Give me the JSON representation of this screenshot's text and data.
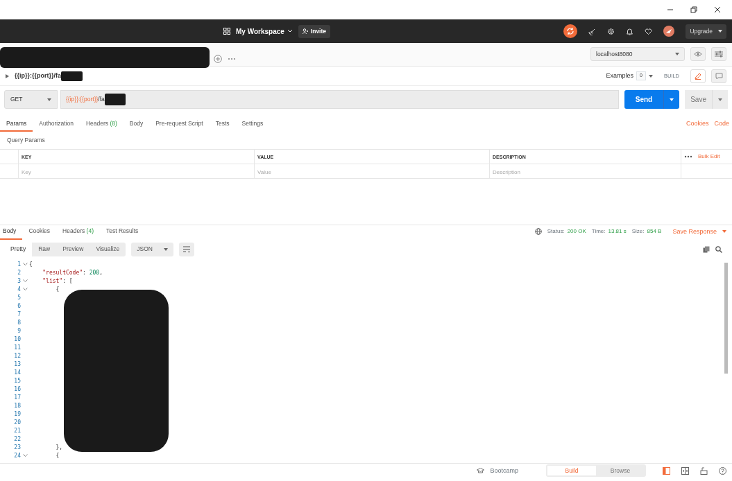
{
  "header": {
    "workspace": "My Workspace",
    "invite": "Invite",
    "upgrade": "Upgrade"
  },
  "environment": "localhost8080",
  "request_name": "{{ip}}:{{port}}/fa",
  "examples": {
    "label": "Examples",
    "count": "0"
  },
  "build_label": "BUILD",
  "url_bar": {
    "method": "GET",
    "variable": "{{ip}}:{{port}}",
    "path": "/fa",
    "send": "Send",
    "save": "Save"
  },
  "request_tabs": [
    {
      "label": "Params",
      "selected": true
    },
    {
      "label": "Authorization",
      "selected": false
    },
    {
      "label": "Headers",
      "count": "(8)",
      "selected": false
    },
    {
      "label": "Body",
      "selected": false
    },
    {
      "label": "Pre-request Script",
      "selected": false
    },
    {
      "label": "Tests",
      "selected": false
    },
    {
      "label": "Settings",
      "selected": false
    }
  ],
  "request_links": [
    "Cookies",
    "Code"
  ],
  "query_params": {
    "title": "Query Params",
    "columns": [
      "KEY",
      "VALUE",
      "DESCRIPTION"
    ],
    "placeholders": [
      "Key",
      "Value",
      "Description"
    ],
    "bulk_edit": "Bulk Edit"
  },
  "response_tabs": [
    {
      "label": "Body",
      "selected": true
    },
    {
      "label": "Cookies",
      "selected": false
    },
    {
      "label": "Headers",
      "count": "(4)",
      "selected": false
    },
    {
      "label": "Test Results",
      "selected": false
    }
  ],
  "status": [
    {
      "label": "Status:",
      "value": "200 OK"
    },
    {
      "label": "Time:",
      "value": "13.81 s"
    },
    {
      "label": "Size:",
      "value": "854 B"
    }
  ],
  "save_response": "Save Response",
  "view_modes": [
    {
      "label": "Pretty",
      "selected": true
    },
    {
      "label": "Raw",
      "selected": false
    },
    {
      "label": "Preview",
      "selected": false
    },
    {
      "label": "Visualize",
      "selected": false
    }
  ],
  "format": "JSON",
  "code_lines": [
    {
      "number": "1",
      "foldable": true,
      "tokens": [
        {
          "kind": "punct",
          "text": "{"
        }
      ]
    },
    {
      "number": "2",
      "foldable": false,
      "tokens": [
        {
          "kind": "key",
          "text": "    \"resultCode\""
        },
        {
          "kind": "punct",
          "text": ": "
        },
        {
          "kind": "number",
          "text": "200"
        },
        {
          "kind": "punct",
          "text": ","
        }
      ]
    },
    {
      "number": "3",
      "foldable": true,
      "tokens": [
        {
          "kind": "key",
          "text": "    \"list\""
        },
        {
          "kind": "punct",
          "text": ": ["
        }
      ]
    },
    {
      "number": "4",
      "foldable": true,
      "tokens": [
        {
          "kind": "punct",
          "text": "        {"
        }
      ]
    },
    {
      "number": "5",
      "foldable": false
    },
    {
      "number": "6",
      "foldable": false
    },
    {
      "number": "7",
      "foldable": false
    },
    {
      "number": "8",
      "foldable": false
    },
    {
      "number": "9",
      "foldable": false
    },
    {
      "number": "10",
      "foldable": false
    },
    {
      "number": "11",
      "foldable": false
    },
    {
      "number": "12",
      "foldable": false
    },
    {
      "number": "13",
      "foldable": false
    },
    {
      "number": "14",
      "foldable": false
    },
    {
      "number": "15",
      "foldable": false
    },
    {
      "number": "16",
      "foldable": false
    },
    {
      "number": "17",
      "foldable": false
    },
    {
      "number": "18",
      "foldable": false
    },
    {
      "number": "19",
      "foldable": false
    },
    {
      "number": "20",
      "foldable": false
    },
    {
      "number": "21",
      "foldable": false
    },
    {
      "number": "22",
      "foldable": false
    },
    {
      "number": "23",
      "foldable": false,
      "tokens": [
        {
          "kind": "punct",
          "text": "        },"
        }
      ]
    },
    {
      "number": "24",
      "foldable": true,
      "tokens": [
        {
          "kind": "punct",
          "text": "        {"
        }
      ]
    }
  ],
  "footer": {
    "bootcamp": "Bootcamp",
    "modes": [
      {
        "label": "Build",
        "selected": true
      },
      {
        "label": "Browse",
        "selected": false
      }
    ]
  }
}
